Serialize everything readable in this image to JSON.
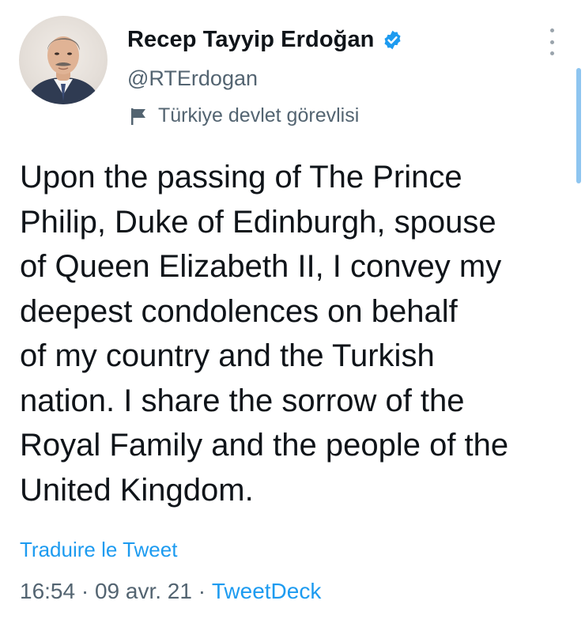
{
  "author": {
    "display_name": "Recep Tayyip Erdoğan",
    "handle": "@RTErdogan",
    "verified": true,
    "label": "Türkiye devlet görevlisi"
  },
  "icons": {
    "avatar": "profile-photo",
    "verified": "verified-badge-icon",
    "label": "flag-icon",
    "more": "more-vertical-icon"
  },
  "tweet": {
    "text": "Upon the passing of The Prince\nPhilip, Duke of Edinburgh, spouse\nof Queen Elizabeth II, I convey my\ndeepest condolences on behalf\nof my country and the Turkish\nnation. I share the sorrow of the\nRoyal Family and the people of the\nUnited Kingdom.",
    "translate_label": "Traduire le Tweet",
    "time": "16:54",
    "date": "09 avr. 21",
    "separator": " · ",
    "source": "TweetDeck"
  },
  "colors": {
    "accent": "#1d9bf0",
    "secondary_text": "#536471",
    "primary_text": "#0f1419"
  }
}
